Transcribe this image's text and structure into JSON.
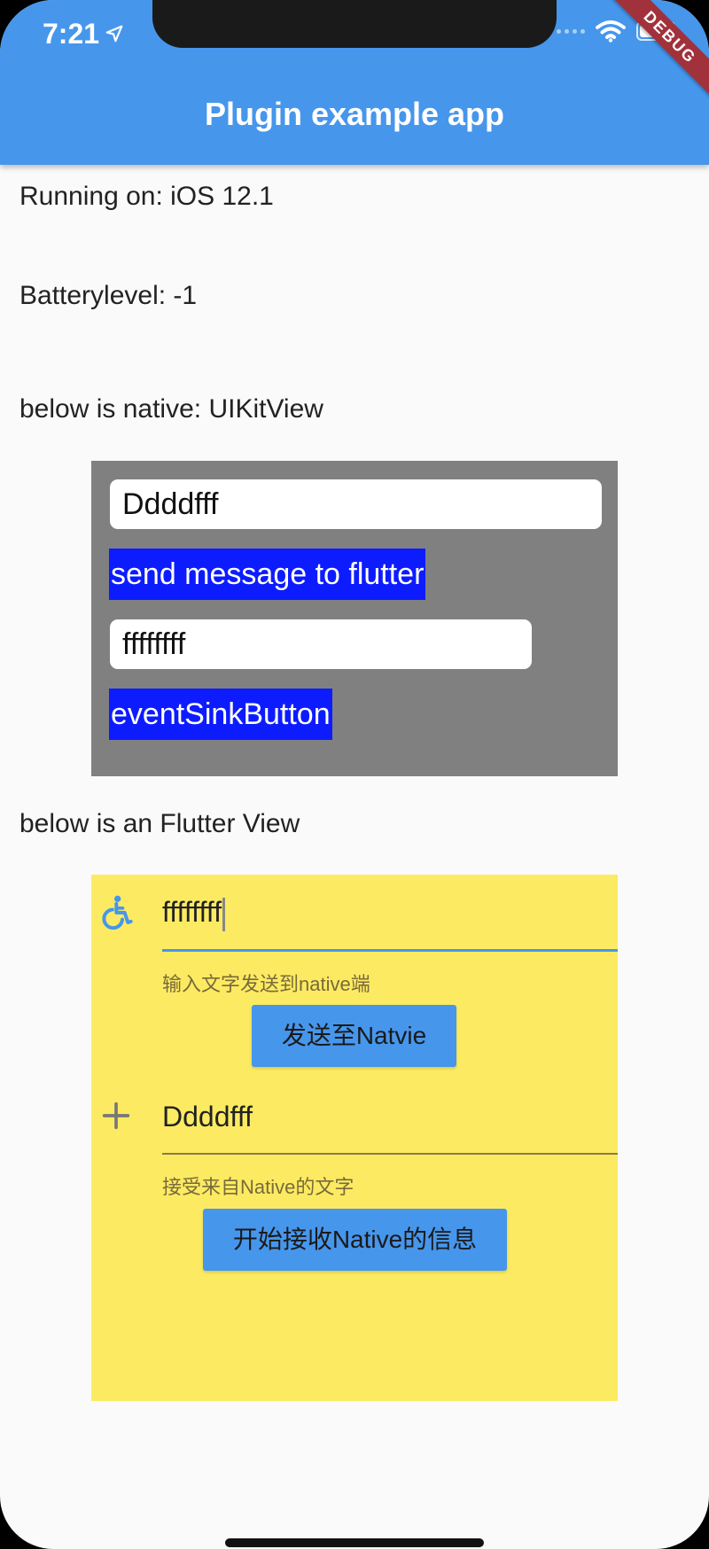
{
  "status_bar": {
    "time": "7:21",
    "debug_label": "DEBUG"
  },
  "appbar": {
    "title": "Plugin example app",
    "color": "#4696ec"
  },
  "info": {
    "running_on": "Running on: iOS 12.1",
    "battery_level": "Batterylevel: -1",
    "native_header": "below is native: UIKitView",
    "flutter_header": "below is an Flutter View"
  },
  "native_view": {
    "input1_value": "Ddddfff",
    "send_button_label": "send message to flutter",
    "input2_value": "ffffffff",
    "event_sink_button_label": "eventSinkButton",
    "background": "#808080",
    "button_color": "#0d1cff"
  },
  "flutter_view": {
    "background": "#fceb62",
    "send_field": {
      "icon": "accessible-icon",
      "value": "ffffffff",
      "helper": "输入文字发送到native端"
    },
    "send_button_label": "发送至Natvie",
    "receive_field": {
      "icon": "add-icon",
      "value": "Ddddfff",
      "helper": "接受来自Native的文字"
    },
    "receive_button_label": "开始接收Native的信息"
  }
}
